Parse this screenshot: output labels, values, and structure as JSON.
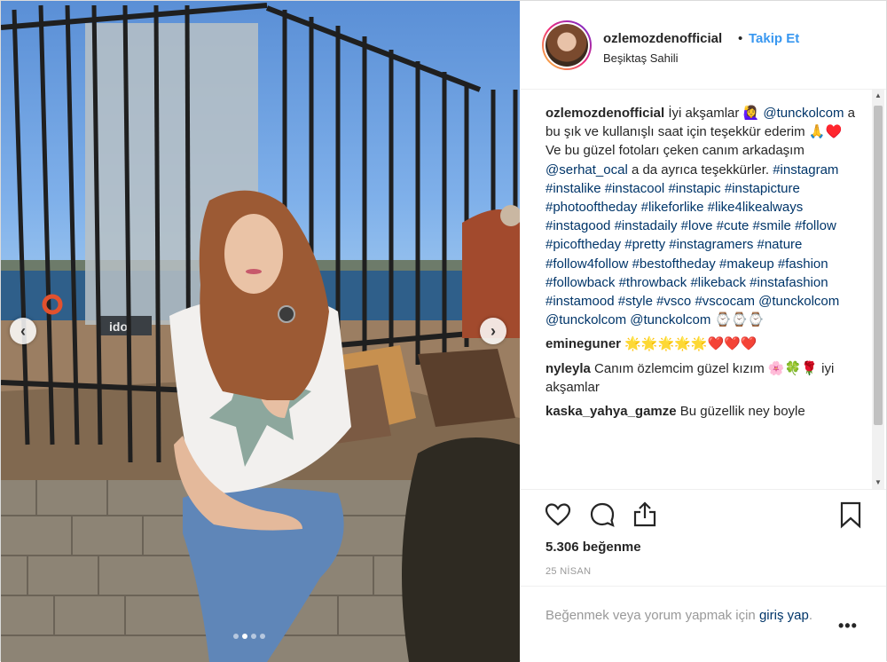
{
  "post": {
    "username": "ozlemozdenofficial",
    "separator": "•",
    "follow_label": "Takip Et",
    "location": "Beşiktaş Sahili",
    "caption": {
      "username": "ozlemozdenofficial",
      "text_parts": [
        {
          "type": "text",
          "value": "İyi akşamlar 🙋‍♀️ "
        },
        {
          "type": "tag",
          "value": "@tunckolcom"
        },
        {
          "type": "text",
          "value": " a bu şık ve kullanışlı saat için teşekkür ederim 🙏♥️ Ve bu güzel fotoları çeken canım arkadaşım "
        },
        {
          "type": "tag",
          "value": "@serhat_ocal"
        },
        {
          "type": "text",
          "value": " a da ayrıca teşekkürler. "
        },
        {
          "type": "tag",
          "value": "#instagram"
        },
        {
          "type": "text",
          "value": " "
        },
        {
          "type": "tag",
          "value": "#instalike"
        },
        {
          "type": "text",
          "value": " "
        },
        {
          "type": "tag",
          "value": "#instacool"
        },
        {
          "type": "text",
          "value": " "
        },
        {
          "type": "tag",
          "value": "#instapic"
        },
        {
          "type": "text",
          "value": " "
        },
        {
          "type": "tag",
          "value": "#instapicture"
        },
        {
          "type": "text",
          "value": " "
        },
        {
          "type": "tag",
          "value": "#photooftheday"
        },
        {
          "type": "text",
          "value": " "
        },
        {
          "type": "tag",
          "value": "#likeforlike"
        },
        {
          "type": "text",
          "value": " "
        },
        {
          "type": "tag",
          "value": "#like4likealways"
        },
        {
          "type": "text",
          "value": " "
        },
        {
          "type": "tag",
          "value": "#instagood"
        },
        {
          "type": "text",
          "value": " "
        },
        {
          "type": "tag",
          "value": "#instadaily"
        },
        {
          "type": "text",
          "value": " "
        },
        {
          "type": "tag",
          "value": "#love"
        },
        {
          "type": "text",
          "value": " "
        },
        {
          "type": "tag",
          "value": "#cute"
        },
        {
          "type": "text",
          "value": " "
        },
        {
          "type": "tag",
          "value": "#smile"
        },
        {
          "type": "text",
          "value": " "
        },
        {
          "type": "tag",
          "value": "#follow"
        },
        {
          "type": "text",
          "value": " "
        },
        {
          "type": "tag",
          "value": "#picoftheday"
        },
        {
          "type": "text",
          "value": " "
        },
        {
          "type": "tag",
          "value": "#pretty"
        },
        {
          "type": "text",
          "value": " "
        },
        {
          "type": "tag",
          "value": "#instagramers"
        },
        {
          "type": "text",
          "value": " "
        },
        {
          "type": "tag",
          "value": "#nature"
        },
        {
          "type": "text",
          "value": " "
        },
        {
          "type": "tag",
          "value": "#follow4follow"
        },
        {
          "type": "text",
          "value": " "
        },
        {
          "type": "tag",
          "value": "#bestoftheday"
        },
        {
          "type": "text",
          "value": " "
        },
        {
          "type": "tag",
          "value": "#makeup"
        },
        {
          "type": "text",
          "value": " "
        },
        {
          "type": "tag",
          "value": "#fashion"
        },
        {
          "type": "text",
          "value": " "
        },
        {
          "type": "tag",
          "value": "#followback"
        },
        {
          "type": "text",
          "value": " "
        },
        {
          "type": "tag",
          "value": "#throwback"
        },
        {
          "type": "text",
          "value": " "
        },
        {
          "type": "tag",
          "value": "#likeback"
        },
        {
          "type": "text",
          "value": " "
        },
        {
          "type": "tag",
          "value": "#instafashion"
        },
        {
          "type": "text",
          "value": " "
        },
        {
          "type": "tag",
          "value": "#instamood"
        },
        {
          "type": "text",
          "value": " "
        },
        {
          "type": "tag",
          "value": "#style"
        },
        {
          "type": "text",
          "value": " "
        },
        {
          "type": "tag",
          "value": "#vsco"
        },
        {
          "type": "text",
          "value": " "
        },
        {
          "type": "tag",
          "value": "#vscocam"
        },
        {
          "type": "text",
          "value": " "
        },
        {
          "type": "tag",
          "value": "@tunckolcom"
        },
        {
          "type": "text",
          "value": " "
        },
        {
          "type": "tag",
          "value": "@tunckolcom"
        },
        {
          "type": "text",
          "value": " "
        },
        {
          "type": "tag",
          "value": "@tunckolcom"
        },
        {
          "type": "text",
          "value": " ⌚⌚⌚"
        }
      ]
    },
    "comments": [
      {
        "username": "emineguner",
        "text": "🌟🌟🌟🌟🌟❤️❤️❤️"
      },
      {
        "username": "nyleyla",
        "text": "Canım özlemcim güzel kızım 🌸🍀🌹 iyi akşamlar"
      },
      {
        "username": "kaska_yahya_gamze",
        "text": "Bu güzellik ney boyle"
      }
    ],
    "likes": "5.306 beğenme",
    "date": "25 NİSAN",
    "login_prompt": "Beğenmek veya yorum yapmak için",
    "login_link": "giriş yap",
    "login_end": ".",
    "photo": {
      "sign_text": "ido",
      "carousel_total": 4,
      "carousel_index": 1
    },
    "icons": {
      "like": "heart-icon",
      "comment": "comment-icon",
      "share": "share-icon",
      "save": "bookmark-icon",
      "more": "more-options-icon",
      "prev": "chevron-left-icon",
      "next": "chevron-right-icon"
    },
    "colors": {
      "link": "#003569",
      "follow": "#3897f0",
      "text": "#262626",
      "muted": "#999999"
    }
  }
}
